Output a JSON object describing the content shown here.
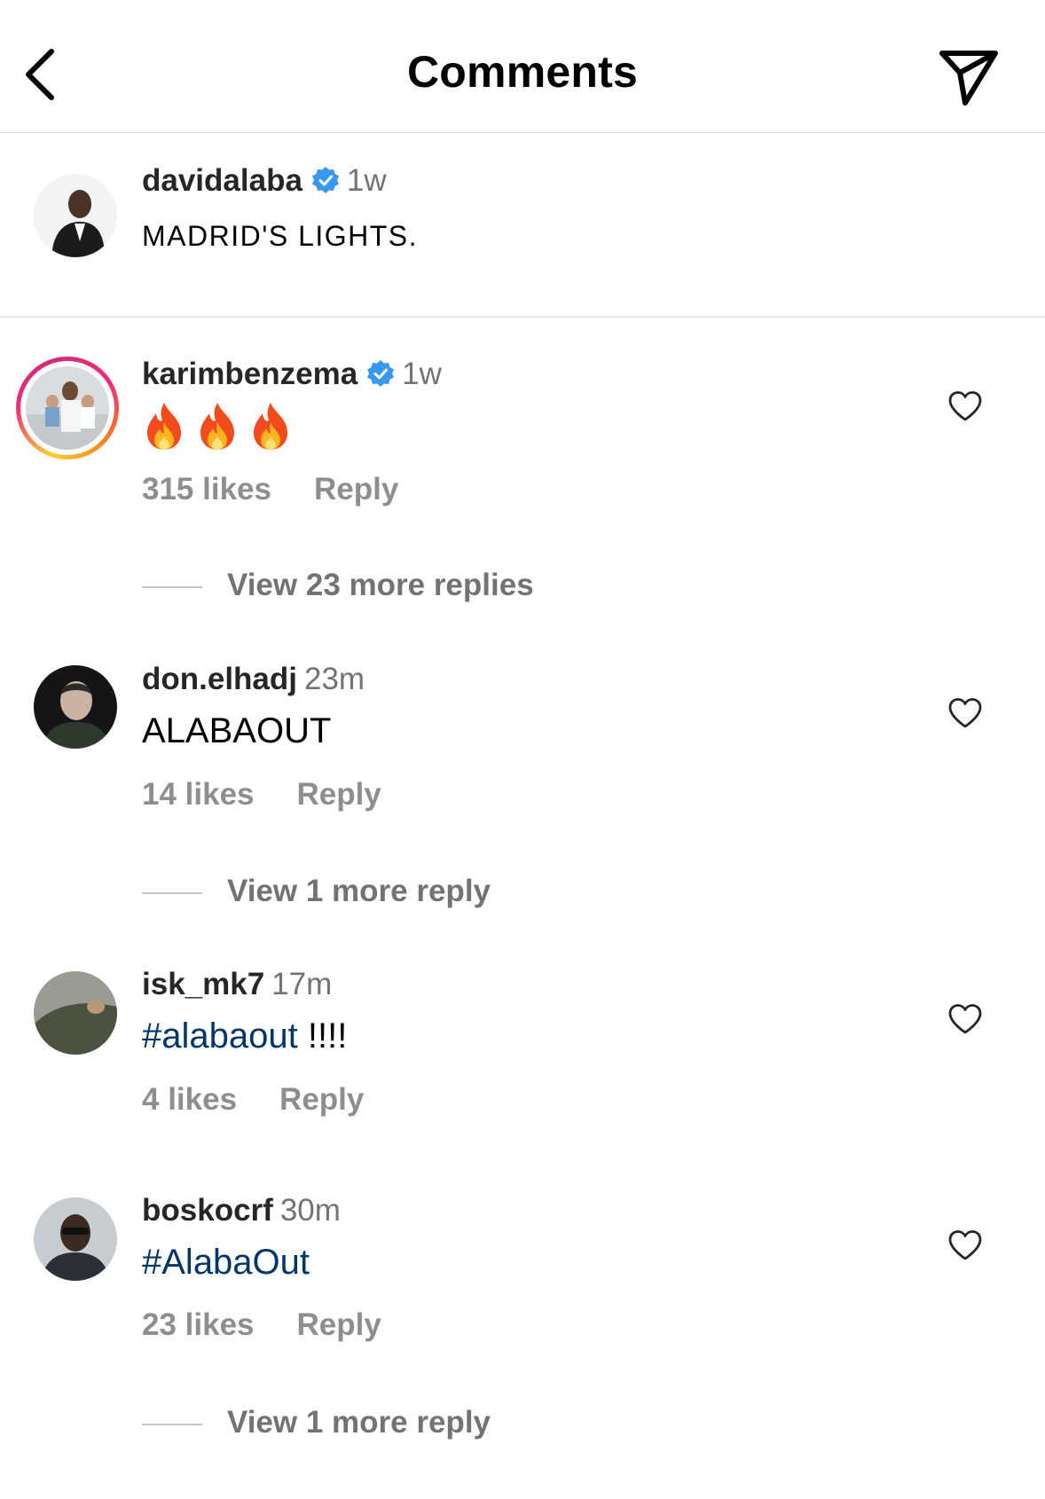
{
  "header": {
    "title": "Comments"
  },
  "caption": {
    "username": "davidalaba",
    "verified": true,
    "time": "1w",
    "text": "MADRID'S LIGHTS."
  },
  "comments": [
    {
      "username": "karimbenzema",
      "verified": true,
      "time": "1w",
      "text": "🔥🔥🔥",
      "likes": "315 likes",
      "reply_label": "Reply",
      "view_replies": "View 23 more replies",
      "has_story_ring": true
    },
    {
      "username": "don.elhadj",
      "time": "23m",
      "text": "ALABAOUT",
      "likes": "14 likes",
      "reply_label": "Reply",
      "view_replies": "View 1 more reply"
    },
    {
      "username": "isk_mk7",
      "time": "17m",
      "hashtag": "#alabaout",
      "text_suffix": " !!!!",
      "likes": "4 likes",
      "reply_label": "Reply"
    },
    {
      "username": "boskocrf",
      "time": "30m",
      "hashtag": "#AlabaOut",
      "likes": "23 likes",
      "reply_label": "Reply",
      "view_replies": "View 1 more reply"
    }
  ],
  "icons": {
    "back": "chevron-left-icon",
    "send": "paper-plane-icon",
    "like": "heart-outline-icon",
    "verified": "verified-badge-icon"
  },
  "colors": {
    "verified": "#3897f0",
    "hashtag": "#00376b",
    "meta": "#8e8e8e",
    "divider": "#dbdbdb"
  }
}
